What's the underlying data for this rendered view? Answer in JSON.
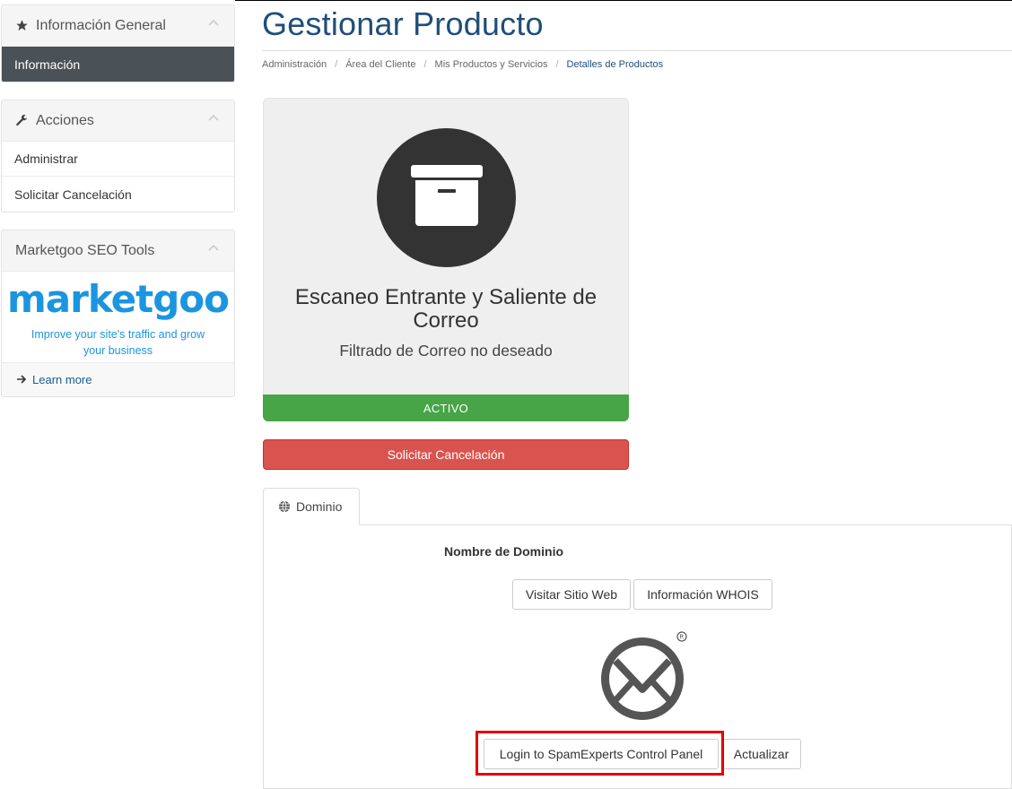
{
  "sidebar": {
    "info_panel": {
      "title": "Información General",
      "items": [
        {
          "label": "Información"
        }
      ]
    },
    "actions_panel": {
      "title": "Acciones",
      "items": [
        {
          "label": "Administrar"
        },
        {
          "label": "Solicitar Cancelación"
        }
      ]
    },
    "marketgoo_panel": {
      "title": "Marketgoo SEO Tools",
      "logo_text": "marketgoo",
      "tagline": "Improve your site's traffic and grow your business",
      "learn_more": "Learn more"
    }
  },
  "header": {
    "title": "Gestionar Producto",
    "breadcrumb": [
      "Administración",
      "Área del Cliente",
      "Mis Productos y Servicios",
      "Detalles de Productos"
    ]
  },
  "product": {
    "name": "Escaneo Entrante y Saliente de Correo",
    "group": "Filtrado de Correo no deseado",
    "status": "ACTIVO",
    "cancel_label": "Solicitar Cancelación"
  },
  "tabs": [
    {
      "label": "Dominio"
    }
  ],
  "domain": {
    "label": "Nombre de Dominio",
    "visit_button": "Visitar Sitio Web",
    "whois_button": "Información WHOIS",
    "login_button": "Login to SpamExperts Control Panel",
    "update_button": "Actualizar"
  },
  "colors": {
    "title": "#1f4e79",
    "active_green": "#47a447",
    "cancel_red": "#d9534f",
    "marketgoo_blue": "#1b95e0",
    "highlight_red": "#e30000"
  }
}
